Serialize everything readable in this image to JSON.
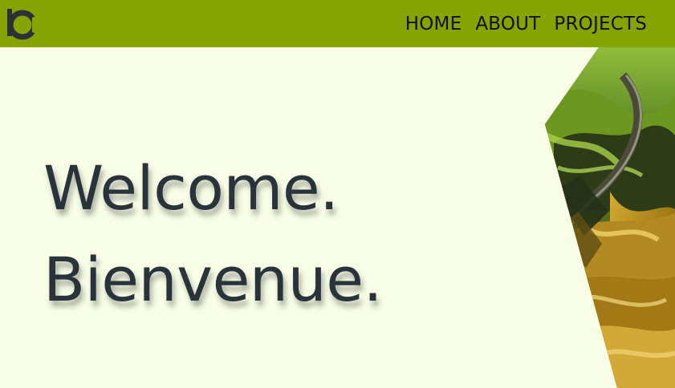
{
  "navbar": {
    "logo_icon": "bc-logo-icon",
    "links": [
      {
        "label": "HOME"
      },
      {
        "label": "ABOUT"
      },
      {
        "label": "PROJECTS"
      }
    ],
    "background_color": "#86a300"
  },
  "hero": {
    "headline_en": "Welcome.",
    "headline_fr": "Bienvenue.",
    "text_color": "#28333b",
    "background_color": "#f8fde6",
    "image_icon": "kelp-seaweed-photo"
  }
}
